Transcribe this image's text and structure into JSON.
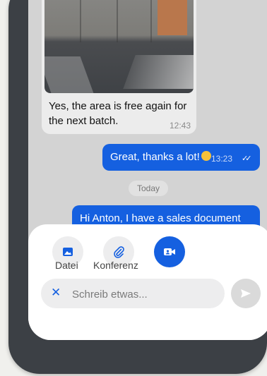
{
  "chat": {
    "photo_message": {
      "text": "Yes, the area is free again for the next batch.",
      "time": "12:43"
    },
    "outgoing_1": {
      "text": "Great, thanks a lot!",
      "emoji": "grinning-face",
      "time": "13:23"
    },
    "date_separator": "Today",
    "outgoing_2": {
      "text": "Hi Anton, I have a sales document"
    }
  },
  "attach_sheet": {
    "items": [
      {
        "label": "Datei",
        "icon": "image-icon"
      },
      {
        "label": "Konferenz",
        "icon": "paperclip-icon"
      },
      {
        "label": "",
        "icon": "video-call-icon"
      }
    ],
    "input_placeholder": "Schreib etwas...",
    "accent_color": "#1560e0"
  }
}
